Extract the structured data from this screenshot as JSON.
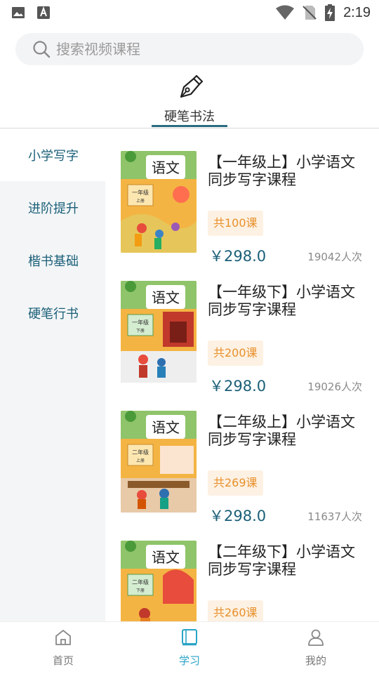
{
  "status_bar": {
    "time": "2:19",
    "icons": [
      "image-icon",
      "font-icon",
      "wifi-icon",
      "no-sim-icon",
      "battery-charging-icon"
    ]
  },
  "search": {
    "placeholder": "搜索视频课程"
  },
  "category": {
    "label": "硬笔书法",
    "icon": "pen-icon"
  },
  "sidebar": {
    "items": [
      {
        "label": "小学写字",
        "active": true
      },
      {
        "label": "进阶提升",
        "active": false
      },
      {
        "label": "楷书基础",
        "active": false
      },
      {
        "label": "硬笔行书",
        "active": false
      }
    ]
  },
  "courses": [
    {
      "title": "【一年级上】小学语文同步写字课程",
      "lessons": "共100课",
      "price": "￥298.0",
      "students": "19042人次"
    },
    {
      "title": "【一年级下】小学语文同步写字课程",
      "lessons": "共200课",
      "price": "￥298.0",
      "students": "19026人次"
    },
    {
      "title": "【二年级上】小学语文同步写字课程",
      "lessons": "共269课",
      "price": "￥298.0",
      "students": "11637人次"
    },
    {
      "title": "【二年级下】小学语文同步写字课程",
      "lessons": "共260课",
      "price": "",
      "students": ""
    }
  ],
  "cover_text": {
    "book": "语文",
    "grades": [
      "一年级",
      "一年级",
      "二年级",
      "二年级"
    ],
    "volumes": [
      "上册",
      "下册",
      "上册",
      "下册"
    ]
  },
  "bottom_nav": {
    "items": [
      {
        "label": "首页",
        "icon": "home-icon",
        "active": false
      },
      {
        "label": "学习",
        "icon": "book-icon",
        "active": true
      },
      {
        "label": "我的",
        "icon": "profile-icon",
        "active": false
      }
    ]
  },
  "colors": {
    "accent": "#1a5f78",
    "nav_active": "#2aa3c6",
    "badge_bg": "#fdf1e3",
    "badge_text": "#e8902a",
    "sidebar_bg": "#f3f5f7"
  }
}
